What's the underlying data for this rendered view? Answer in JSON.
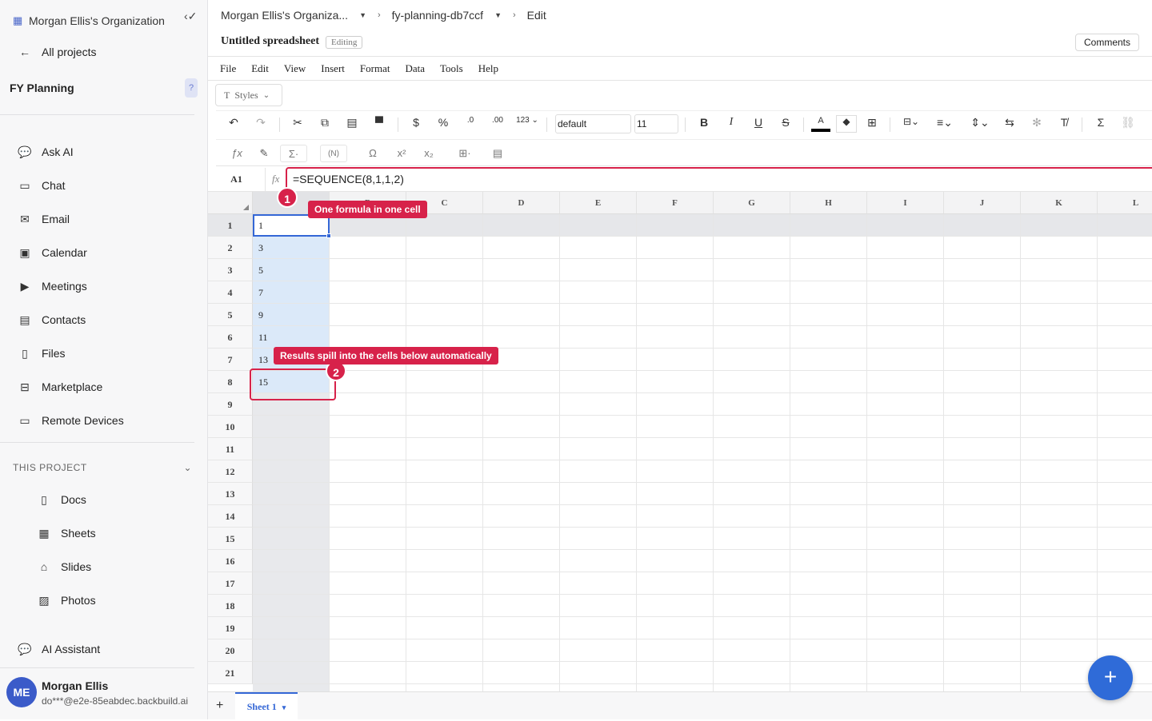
{
  "sidebar": {
    "org_name": "Morgan Ellis's Organization",
    "all_projects": "All projects",
    "project_name": "FY Planning",
    "help": "?",
    "nav": [
      {
        "label": "Ask AI",
        "icon": "chat-bubble-icon"
      },
      {
        "label": "Chat",
        "icon": "chat-icon"
      },
      {
        "label": "Email",
        "icon": "mail-icon"
      },
      {
        "label": "Calendar",
        "icon": "calendar-icon"
      },
      {
        "label": "Meetings",
        "icon": "video-icon"
      },
      {
        "label": "Contacts",
        "icon": "contacts-icon"
      },
      {
        "label": "Files",
        "icon": "file-icon"
      },
      {
        "label": "Marketplace",
        "icon": "store-icon"
      },
      {
        "label": "Remote Devices",
        "icon": "monitor-icon"
      }
    ],
    "section_title": "THIS PROJECT",
    "project_items": [
      {
        "label": "Docs",
        "icon": "doc-icon"
      },
      {
        "label": "Sheets",
        "icon": "sheet-icon"
      },
      {
        "label": "Slides",
        "icon": "slides-icon"
      },
      {
        "label": "Photos",
        "icon": "photo-icon"
      }
    ],
    "ai_assistant": "AI Assistant",
    "user": {
      "initials": "ME",
      "name": "Morgan Ellis",
      "email": "do***@e2e-85eabdec.backbuild.ai"
    }
  },
  "header": {
    "breadcrumb_org": "Morgan Ellis's Organiza...",
    "breadcrumb_project": "fy-planning-db7ccf",
    "breadcrumb_page": "Edit",
    "doc_title": "Untitled spreadsheet",
    "status": "Editing",
    "comments": "Comments"
  },
  "menu": [
    "File",
    "Edit",
    "View",
    "Insert",
    "Format",
    "Data",
    "Tools",
    "Help"
  ],
  "toolbar": {
    "styles": "Styles",
    "font": "default",
    "font_size": "11",
    "number_format": "123"
  },
  "formula_bar": {
    "cell_ref": "A1",
    "fx": "fx",
    "formula": "=SEQUENCE(8,1,1,2)"
  },
  "grid": {
    "columns": [
      "A",
      "B",
      "C",
      "D",
      "E",
      "F",
      "G",
      "H",
      "I",
      "J",
      "K",
      "L"
    ],
    "rows": [
      "1",
      "2",
      "3",
      "4",
      "5",
      "6",
      "7",
      "8",
      "9",
      "10",
      "11",
      "12",
      "13",
      "14",
      "15",
      "16",
      "17",
      "18",
      "19",
      "20",
      "21"
    ],
    "colA_values": [
      "1",
      "3",
      "5",
      "7",
      "9",
      "11",
      "13",
      "15"
    ]
  },
  "callouts": [
    {
      "number": "1",
      "text": "One formula in one cell"
    },
    {
      "number": "2",
      "text": "Results spill into the cells below automatically"
    }
  ],
  "sheets": {
    "add": "+",
    "active": "Sheet 1"
  },
  "fab": "+"
}
